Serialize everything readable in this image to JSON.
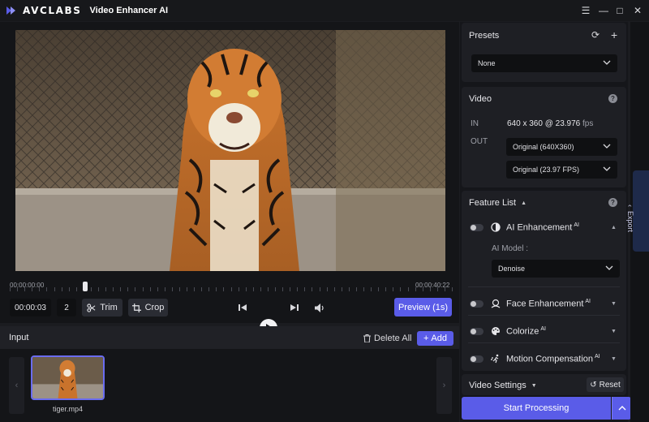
{
  "titlebar": {
    "brand": "AVCLABS",
    "title": "Video Enhancer AI",
    "icons": [
      "menu-icon",
      "minimize-icon",
      "maximize-icon",
      "close-icon"
    ]
  },
  "player": {
    "time_start": "00:00:00:00",
    "time_end": "00:00:40:22",
    "playhead_fraction": 0.17,
    "current_time": "00:00:03",
    "frame_step": "2",
    "trim_label": "Trim",
    "crop_label": "Crop",
    "preview_label": "Preview (1s)"
  },
  "input": {
    "title": "Input",
    "delete_all_label": "Delete All",
    "add_label": "Add",
    "files": [
      {
        "name": "tiger.mp4"
      }
    ]
  },
  "presets": {
    "title": "Presets",
    "selected": "None"
  },
  "video": {
    "title": "Video",
    "in_label": "IN",
    "in_resolution": "640 x 360 @ 23.976",
    "in_fps_unit": "fps",
    "out_label": "OUT",
    "out_resolution": "Original (640X360)",
    "out_fps": "Original (23.97 FPS)"
  },
  "features": {
    "title": "Feature List",
    "items": [
      {
        "label": "AI Enhancement",
        "badge": "AI",
        "enabled": false,
        "expanded": true,
        "icon": "contrast-icon"
      },
      {
        "label": "Face Enhancement",
        "badge": "AI",
        "enabled": false,
        "expanded": false,
        "icon": "face-icon"
      },
      {
        "label": "Colorize",
        "badge": "AI",
        "enabled": false,
        "expanded": false,
        "icon": "palette-icon"
      },
      {
        "label": "Motion Compensation",
        "badge": "AI",
        "enabled": false,
        "expanded": false,
        "icon": "motion-icon"
      }
    ],
    "ai_model_label": "AI Model :",
    "ai_model_value": "Denoise"
  },
  "video_settings": {
    "title": "Video Settings",
    "reset_label": "Reset"
  },
  "actions": {
    "start_label": "Start Processing",
    "export_label": "Export"
  },
  "colors": {
    "accent": "#5a5ce8",
    "background": "#1b1c20",
    "panel": "#1e1f24"
  }
}
